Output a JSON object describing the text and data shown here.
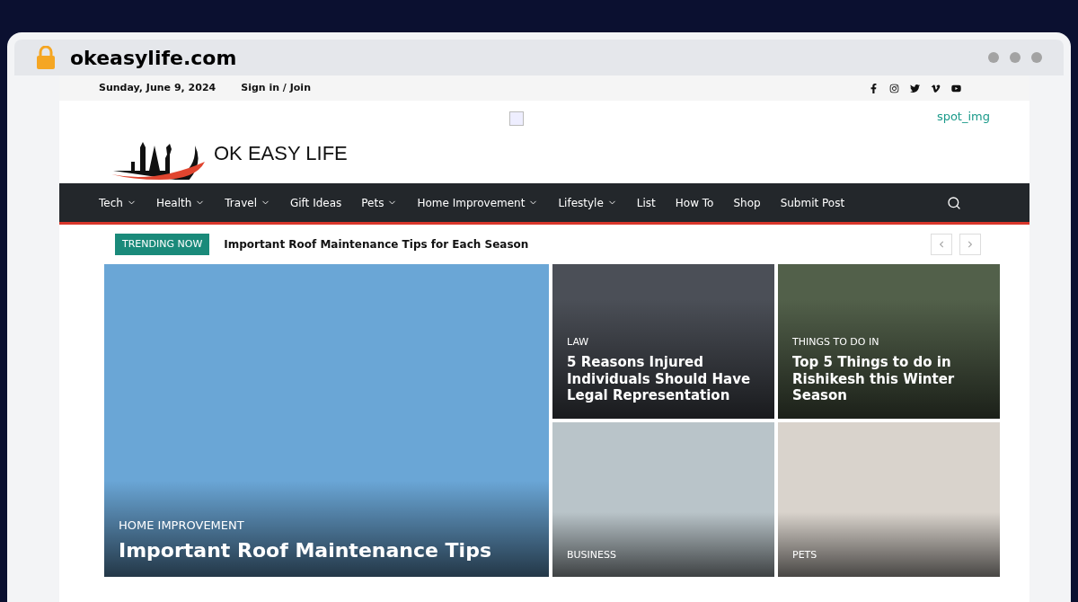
{
  "browser": {
    "url": "okeasylife.com"
  },
  "topbar": {
    "date": "Sunday, June 9, 2024",
    "sign_in": "Sign in / Join"
  },
  "header": {
    "logo_text": "OK EASY LIFE",
    "ad_caption": "spot_img"
  },
  "nav": {
    "items": [
      {
        "label": "Tech",
        "has_menu": true
      },
      {
        "label": "Health",
        "has_menu": true
      },
      {
        "label": "Travel",
        "has_menu": true
      },
      {
        "label": "Gift Ideas",
        "has_menu": false
      },
      {
        "label": "Pets",
        "has_menu": true
      },
      {
        "label": "Home Improvement",
        "has_menu": true
      },
      {
        "label": "Lifestyle",
        "has_menu": true
      },
      {
        "label": "List",
        "has_menu": false
      },
      {
        "label": "How To",
        "has_menu": false
      },
      {
        "label": "Shop",
        "has_menu": false
      },
      {
        "label": "Submit Post",
        "has_menu": false
      }
    ]
  },
  "trending": {
    "badge": "TRENDING NOW",
    "headline": "Important Roof Maintenance Tips for Each Season"
  },
  "featured": [
    {
      "kind": "large",
      "category": "HOME IMPROVEMENT",
      "title": "Important Roof Maintenance Tips"
    },
    {
      "kind": "small",
      "category": "LAW",
      "title": "5 Reasons Injured Individuals Should Have Legal Representation"
    },
    {
      "kind": "small",
      "category": "THINGS TO DO IN",
      "title": "Top 5 Things to do in Rishikesh this Winter Season"
    },
    {
      "kind": "small",
      "category": "BUSINESS"
    },
    {
      "kind": "small",
      "category": "PETS"
    }
  ]
}
